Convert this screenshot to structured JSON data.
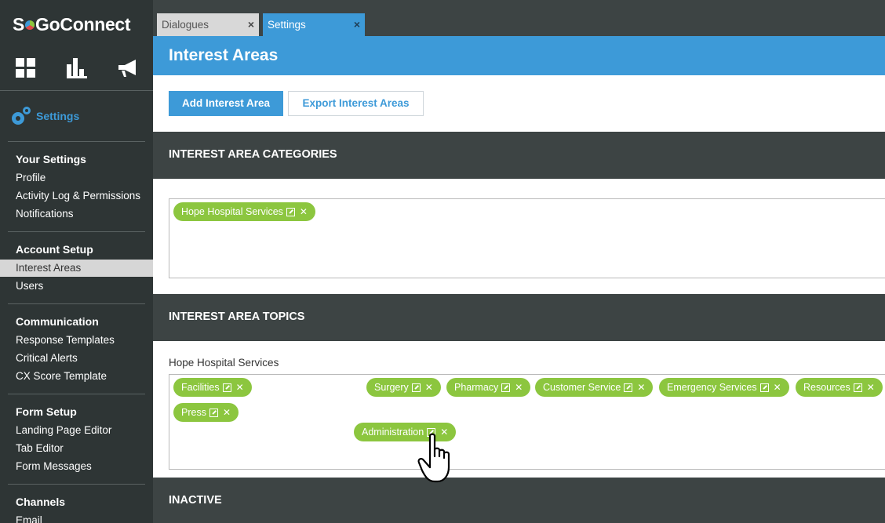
{
  "app": {
    "logo_text_before": "S",
    "logo_text_after": "GoConnect"
  },
  "nav_icons": [
    "dashboard-icon",
    "bar-chart-icon",
    "megaphone-icon"
  ],
  "sidebar": {
    "settings_label": "Settings",
    "groups": [
      {
        "title": "Your Settings",
        "items": [
          "Profile",
          "Activity Log & Permissions",
          "Notifications"
        ]
      },
      {
        "title": "Account Setup",
        "items": [
          "Interest Areas",
          "Users"
        ]
      },
      {
        "title": "Communication",
        "items": [
          "Response Templates",
          "Critical Alerts",
          "CX Score Template"
        ]
      },
      {
        "title": "Form Setup",
        "items": [
          "Landing Page Editor",
          "Tab Editor",
          "Form Messages"
        ]
      },
      {
        "title": "Channels",
        "items": [
          "Email"
        ]
      }
    ],
    "active_item": "Interest Areas"
  },
  "tabs": [
    {
      "label": "Dialogues",
      "close": "×"
    },
    {
      "label": "Settings",
      "close": "×"
    }
  ],
  "page": {
    "title": "Interest Areas",
    "add_button": "Add Interest Area",
    "export_button": "Export Interest Areas"
  },
  "sections": {
    "categories": {
      "title": "INTEREST AREA CATEGORIES",
      "chips": [
        "Hope Hospital Services"
      ]
    },
    "topics": {
      "title": "INTEREST AREA TOPICS",
      "group_label": "Hope Hospital Services",
      "chips": [
        "Facilities",
        "Surgery",
        "Pharmacy",
        "Customer Service",
        "Emergency Services",
        "Resources",
        "Press"
      ],
      "dragging_chip": "Administration"
    },
    "inactive": {
      "title": "INACTIVE"
    }
  },
  "colors": {
    "accent": "#3d9ad8",
    "chip": "#8cc63f",
    "dark": "#3d4444"
  }
}
